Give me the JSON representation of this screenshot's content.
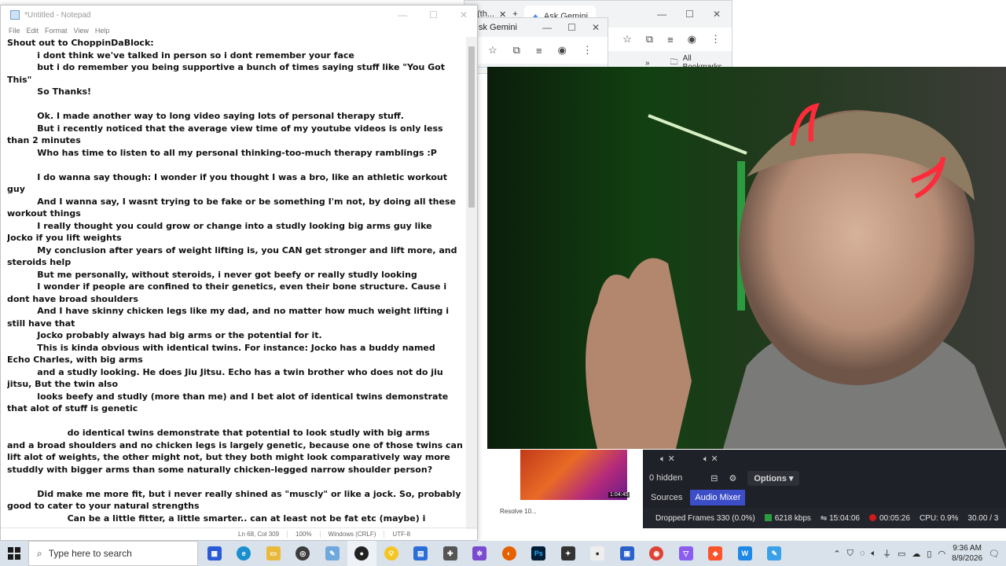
{
  "notepad": {
    "title": "*Untitled - Notepad",
    "menu": [
      "File",
      "Edit",
      "Format",
      "View",
      "Help"
    ],
    "lines": [
      "Shout out to ChoppinDaBlock:",
      "          i dont think we've talked in person so i dont remember your face",
      "          but i do remember you being supportive a bunch of times saying stuff like \"You Got",
      "This\"",
      "          So Thanks!",
      "",
      "          Ok. I made another way to long video saying lots of personal therapy stuff.",
      "          But i recently noticed that the average view time of my youtube videos is only less",
      "than 2 minutes",
      "          Who has time to listen to all my personal thinking-too-much therapy ramblings :P",
      "",
      "          I do wanna say though: I wonder if you thought I was a bro, like an athletic workout",
      "guy",
      "          And I wanna say, I wasnt trying to be fake or be something I'm not, by doing all these",
      "workout things",
      "          I really thought you could grow or change into a studly looking big arms guy like",
      "Jocko if you lift weights",
      "          My conclusion after years of weight lifting is, you CAN get stronger and lift more, and",
      "steroids help",
      "          But me personally, without steroids, i never got beefy or really studly looking",
      "          I wonder if people are confined to their genetics, even their bone structure. Cause i",
      "dont have broad shoulders",
      "          And I have skinny chicken legs like my dad, and no matter how much weight lifting i",
      "still have that",
      "          Jocko probably always had big arms or the potential for it.",
      "          This is kinda obvious with identical twins. For instance: Jocko has a buddy named",
      "Echo Charles, with big arms",
      "          and a studly looking. He does Jiu Jitsu. Echo has a twin brother who does not do jiu",
      "jitsu, But the twin also",
      "          looks beefy and studly (more than me) and I bet alot of identical twins demonstrate",
      "that alot of stuff is genetic",
      "",
      "                    do identical twins demonstrate that potential to look studly with big arms",
      "and a broad shoulders and no chicken legs is largely genetic, because one of those twins can",
      "lift alot of weights, the other might not, but they both might look comparatively way more",
      "studdly with bigger arms than some naturally chicken-legged narrow shoulder person?",
      "",
      "          Did make me more fit, but i never really shined as \"muscly\" or like a jock. So, probably",
      "good to cater to your natural strengths",
      "                    Can be a little fitter, a little smarter.. can at least not be fat etc (maybe) i"
    ],
    "status": {
      "position": "Ln 68, Col 309",
      "zoom": "100%",
      "line_ending": "Windows (CRLF)",
      "encoding": "UTF-8"
    }
  },
  "browser_back": {
    "tab_partial": "(th...",
    "tab_active": "Ask Gemini",
    "bookmarks": "All Bookmarks"
  },
  "browser_mid": {
    "tab": "sk Gemini"
  },
  "obs": {
    "hidden": "0 hidden",
    "options": "Options",
    "tabs": [
      "Sources",
      "Audio Mixer"
    ],
    "dropped_frames": "Dropped Frames 330 (0.0%)",
    "bitrate": "6218 kbps",
    "stream_time": "15:04:06",
    "rec_time": "00:05:26",
    "cpu": "CPU: 0.9%",
    "fps": "30.00 / 3"
  },
  "desktop": {
    "thumb_label": "Resolve 10...",
    "thumb_time": "1:04:45"
  },
  "taskbar": {
    "search_placeholder": "Type here to search",
    "time": "9:36 AM",
    "date": "8/9/2026"
  },
  "colors": {
    "obs_bg": "#1f2128",
    "obs_accent": "#3b4ec8",
    "rec_red": "#d11a1a",
    "taskbar_bg": "#d9e2ea"
  }
}
